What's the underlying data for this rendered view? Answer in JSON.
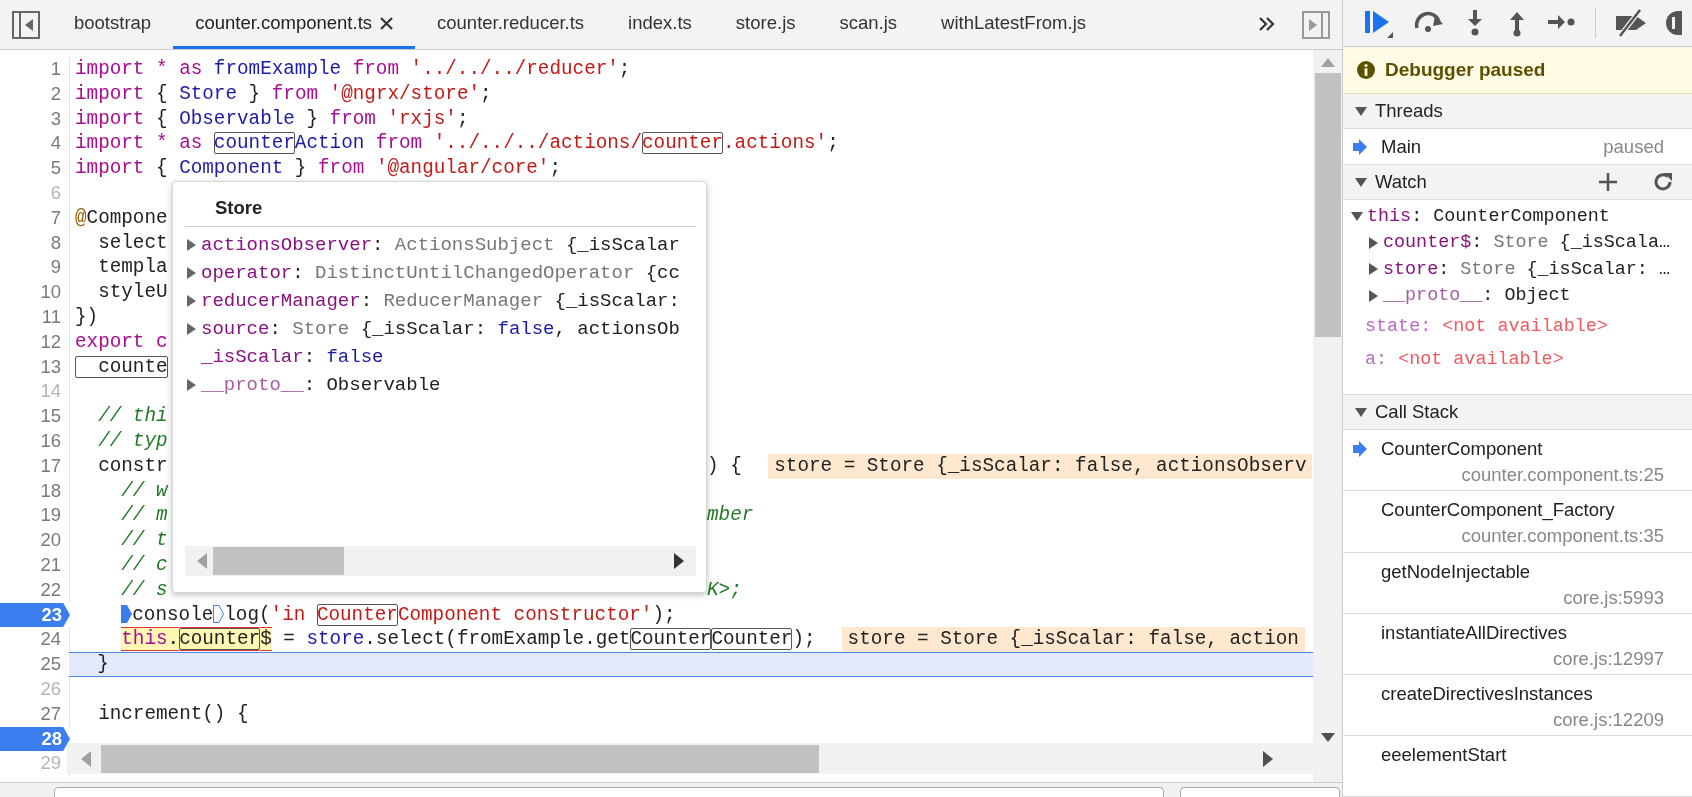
{
  "tabs": [
    {
      "label": "bootstrap",
      "selected": false,
      "closable": false
    },
    {
      "label": "counter.component.ts",
      "selected": true,
      "closable": true
    },
    {
      "label": "counter.reducer.ts",
      "selected": false,
      "closable": false
    },
    {
      "label": "index.ts",
      "selected": false,
      "closable": false
    },
    {
      "label": "store.js",
      "selected": false,
      "closable": false
    },
    {
      "label": "scan.js",
      "selected": false,
      "closable": false
    },
    {
      "label": "withLatestFrom.js",
      "selected": false,
      "closable": false
    }
  ],
  "editor": {
    "lines": [
      {
        "number": "1",
        "breakpoint": false,
        "current": false,
        "code": [
          {
            "kind": "keyword",
            "text": "import * as"
          },
          {
            "kind": "name",
            "text": " fromExample"
          },
          {
            "kind": "keyword",
            "text": " from"
          },
          {
            "kind": "string",
            "text": " '../../../reducer'"
          },
          {
            "kind": "plain",
            "text": ";"
          }
        ]
      },
      {
        "number": "2",
        "breakpoint": false,
        "current": false,
        "code": [
          {
            "kind": "keyword",
            "text": "import"
          },
          {
            "kind": "plain",
            "text": " { "
          },
          {
            "kind": "name",
            "text": "Store"
          },
          {
            "kind": "plain",
            "text": " } "
          },
          {
            "kind": "keyword",
            "text": "from"
          },
          {
            "kind": "string",
            "text": " '@ngrx/store'"
          },
          {
            "kind": "plain",
            "text": ";"
          }
        ]
      },
      {
        "number": "3",
        "breakpoint": false,
        "current": false,
        "code": [
          {
            "kind": "keyword",
            "text": "import"
          },
          {
            "kind": "plain",
            "text": " { "
          },
          {
            "kind": "name",
            "text": "Observable"
          },
          {
            "kind": "plain",
            "text": " } "
          },
          {
            "kind": "keyword",
            "text": "from"
          },
          {
            "kind": "string",
            "text": " 'rxjs'"
          },
          {
            "kind": "plain",
            "text": ";"
          }
        ]
      },
      {
        "number": "4",
        "breakpoint": false,
        "current": false,
        "code": [
          {
            "kind": "keyword",
            "text": "import * as "
          },
          {
            "kind": "name",
            "text": "counter",
            "match": true
          },
          {
            "kind": "name",
            "text": "Action"
          },
          {
            "kind": "keyword",
            "text": " from"
          },
          {
            "kind": "string",
            "text": " '../../../actions/"
          },
          {
            "kind": "string",
            "text": "counter",
            "match": true
          },
          {
            "kind": "string",
            "text": ".actions'"
          },
          {
            "kind": "plain",
            "text": ";"
          }
        ]
      },
      {
        "number": "5",
        "breakpoint": false,
        "current": false,
        "code": [
          {
            "kind": "keyword",
            "text": "import"
          },
          {
            "kind": "plain",
            "text": " { "
          },
          {
            "kind": "name",
            "text": "Component"
          },
          {
            "kind": "plain",
            "text": " } "
          },
          {
            "kind": "keyword",
            "text": "from"
          },
          {
            "kind": "string",
            "text": " '@angular/core'"
          },
          {
            "kind": "plain",
            "text": ";"
          }
        ]
      },
      {
        "number": "6",
        "breakpoint": false,
        "current": false
      },
      {
        "number": "7",
        "breakpoint": false,
        "current": false,
        "code": [
          {
            "kind": "decorator",
            "text": "@"
          },
          {
            "kind": "plain",
            "text": "Compone"
          }
        ]
      },
      {
        "number": "8",
        "breakpoint": false,
        "current": false,
        "code": [
          {
            "kind": "plain",
            "text": "  select"
          }
        ]
      },
      {
        "number": "9",
        "breakpoint": false,
        "current": false,
        "code": [
          {
            "kind": "plain",
            "text": "  templa"
          }
        ]
      },
      {
        "number": "10",
        "breakpoint": false,
        "current": false,
        "code": [
          {
            "kind": "plain",
            "text": "  styleU"
          }
        ]
      },
      {
        "number": "11",
        "breakpoint": false,
        "current": false,
        "code": [
          {
            "kind": "plain",
            "text": "})"
          }
        ]
      },
      {
        "number": "12",
        "breakpoint": false,
        "current": false,
        "code": [
          {
            "kind": "keyword",
            "text": "export c"
          }
        ]
      },
      {
        "number": "13",
        "breakpoint": false,
        "current": false,
        "code": [
          {
            "kind": "plain",
            "text": "  counte",
            "match": true
          }
        ]
      },
      {
        "number": "14",
        "breakpoint": false,
        "current": false
      },
      {
        "number": "15",
        "breakpoint": false,
        "current": false,
        "code": [
          {
            "kind": "comment",
            "text": "  // thi"
          }
        ]
      },
      {
        "number": "16",
        "breakpoint": false,
        "current": false,
        "code": [
          {
            "kind": "comment",
            "text": "  // typ"
          }
        ]
      },
      {
        "number": "17",
        "breakpoint": false,
        "current": false,
        "code": [
          {
            "kind": "plain",
            "text": "  constr"
          }
        ],
        "code_after_popup": [
          {
            "kind": "plain",
            "text": ") {"
          }
        ],
        "inline_value": "store = Store {_isScalar: false, actionsObserv"
      },
      {
        "number": "18",
        "breakpoint": false,
        "current": false,
        "code": [
          {
            "kind": "comment",
            "text": "    // w"
          }
        ]
      },
      {
        "number": "19",
        "breakpoint": false,
        "current": false,
        "code": [
          {
            "kind": "comment",
            "text": "    // m"
          }
        ],
        "code_after_popup": [
          {
            "kind": "comment",
            "text": "mber"
          }
        ]
      },
      {
        "number": "20",
        "breakpoint": false,
        "current": false,
        "code": [
          {
            "kind": "comment",
            "text": "    // t"
          }
        ]
      },
      {
        "number": "21",
        "breakpoint": false,
        "current": false,
        "code": [
          {
            "kind": "comment",
            "text": "    // c"
          }
        ]
      },
      {
        "number": "22",
        "breakpoint": false,
        "current": false,
        "code": [
          {
            "kind": "comment",
            "text": "    // s"
          }
        ],
        "code_after_popup": [
          {
            "kind": "comment",
            "text": "K>;"
          }
        ]
      },
      {
        "number": "23",
        "breakpoint": true,
        "current": false,
        "code": [
          {
            "kind": "marker-solid"
          },
          {
            "kind": "plain",
            "text": "console"
          },
          {
            "kind": "marker-outline"
          },
          {
            "kind": "plain",
            "text": "log("
          },
          {
            "kind": "string",
            "text": "'in "
          },
          {
            "kind": "string",
            "text": "Counter",
            "match": true
          },
          {
            "kind": "string",
            "text": "Component constructor'"
          },
          {
            "kind": "plain",
            "text": ");"
          }
        ]
      },
      {
        "number": "24",
        "breakpoint": false,
        "current": false,
        "code": [
          {
            "kind": "keyword",
            "text": "this",
            "highlight": true
          },
          {
            "kind": "plain",
            "text": ".",
            "highlight": true
          },
          {
            "kind": "plain",
            "text": "counter",
            "highlight": true,
            "match": true
          },
          {
            "kind": "plain",
            "text": "$",
            "highlight": true
          },
          {
            "kind": "plain",
            "text": " = "
          },
          {
            "kind": "name",
            "text": "store"
          },
          {
            "kind": "plain",
            "text": ".select(fromExample.get"
          },
          {
            "kind": "plain",
            "text": "Counter",
            "match": true
          },
          {
            "kind": "plain",
            "text": "Counter",
            "match": true
          },
          {
            "kind": "plain",
            "text": ");"
          }
        ],
        "inline_value": "store = Store {_isScalar: false, action"
      },
      {
        "number": "25",
        "breakpoint": false,
        "current": true,
        "code": [
          {
            "kind": "plain",
            "text": "  }"
          }
        ]
      },
      {
        "number": "26",
        "breakpoint": false,
        "current": false
      },
      {
        "number": "27",
        "breakpoint": false,
        "current": false,
        "code": [
          {
            "kind": "plain",
            "text": "  increment() {"
          }
        ]
      },
      {
        "number": "28",
        "breakpoint": true,
        "current": false
      },
      {
        "number": "29",
        "breakpoint": false,
        "current": false
      }
    ]
  },
  "popup": {
    "title": "Store",
    "properties": [
      {
        "name": "actionsObserver",
        "expandable": true,
        "internal": false,
        "value": [
          {
            "kind": "plain",
            "text": ": "
          },
          {
            "kind": "type",
            "text": "ActionsSubject"
          },
          {
            "kind": "plain",
            "text": " {_isScalar"
          }
        ]
      },
      {
        "name": "operator",
        "expandable": true,
        "internal": false,
        "value": [
          {
            "kind": "plain",
            "text": ": "
          },
          {
            "kind": "type",
            "text": "DistinctUntilChangedOperator"
          },
          {
            "kind": "plain",
            "text": " {cc"
          }
        ]
      },
      {
        "name": "reducerManager",
        "expandable": true,
        "internal": false,
        "value": [
          {
            "kind": "plain",
            "text": ": "
          },
          {
            "kind": "type",
            "text": "ReducerManager"
          },
          {
            "kind": "plain",
            "text": " {_isScalar:"
          }
        ]
      },
      {
        "name": "source",
        "expandable": true,
        "internal": false,
        "value": [
          {
            "kind": "plain",
            "text": ": "
          },
          {
            "kind": "type",
            "text": "Store"
          },
          {
            "kind": "plain",
            "text": " {_isScalar: "
          },
          {
            "kind": "atom",
            "text": "false"
          },
          {
            "kind": "plain",
            "text": ", actionsOb"
          }
        ]
      },
      {
        "name": "_isScalar",
        "expandable": false,
        "internal": false,
        "value": [
          {
            "kind": "plain",
            "text": ": "
          },
          {
            "kind": "atom",
            "text": "false"
          }
        ]
      },
      {
        "name": "__proto__",
        "expandable": true,
        "internal": true,
        "value": [
          {
            "kind": "plain",
            "text": ": Observable"
          }
        ]
      }
    ]
  },
  "debugger": {
    "status": "Debugger paused",
    "threads": {
      "title": "Threads",
      "expanded": true,
      "items": [
        {
          "name": "Main",
          "status": "paused",
          "current": true
        }
      ]
    },
    "watch": {
      "title": "Watch",
      "expanded": true,
      "items": [
        {
          "kind": "object",
          "name": "this",
          "expanded": true,
          "internal": false,
          "value": [
            {
              "kind": "plain",
              "text": ": CounterComponent"
            }
          ],
          "children": [
            {
              "kind": "object",
              "name": "counter$",
              "expanded": false,
              "internal": false,
              "value": [
                {
                  "kind": "plain",
                  "text": ": "
                },
                {
                  "kind": "type",
                  "text": "Store"
                },
                {
                  "kind": "plain",
                  "text": " {_isScala…"
                }
              ]
            },
            {
              "kind": "object",
              "name": "store",
              "expanded": false,
              "internal": false,
              "value": [
                {
                  "kind": "plain",
                  "text": ": "
                },
                {
                  "kind": "type",
                  "text": "Store"
                },
                {
                  "kind": "plain",
                  "text": " {_isScalar: …"
                }
              ]
            },
            {
              "kind": "object",
              "name": "__proto__",
              "expanded": false,
              "internal": true,
              "value": [
                {
                  "kind": "plain",
                  "text": ": Object"
                }
              ]
            }
          ]
        },
        {
          "kind": "unavailable",
          "name": "state",
          "value": [
            {
              "kind": "unavailable-sep",
              "text": ": "
            },
            {
              "kind": "error",
              "text": "<not available>"
            }
          ]
        },
        {
          "kind": "unavailable",
          "name": "a",
          "value": [
            {
              "kind": "unavailable-sep",
              "text": ": "
            },
            {
              "kind": "error",
              "text": "<not available>"
            }
          ]
        }
      ]
    },
    "call_stack": {
      "title": "Call Stack",
      "expanded": true,
      "frames": [
        {
          "name": "CounterComponent",
          "location": "counter.component.ts:25",
          "current": true
        },
        {
          "name": "CounterComponent_Factory",
          "location": "counter.component.ts:35",
          "current": false
        },
        {
          "name": "getNodeInjectable",
          "location": "core.js:5993",
          "current": false
        },
        {
          "name": "instantiateAllDirectives",
          "location": "core.js:12997",
          "current": false
        },
        {
          "name": "createDirectivesInstances",
          "location": "core.js:12209",
          "current": false
        },
        {
          "name": "eeelementStart",
          "current": false
        }
      ]
    }
  }
}
